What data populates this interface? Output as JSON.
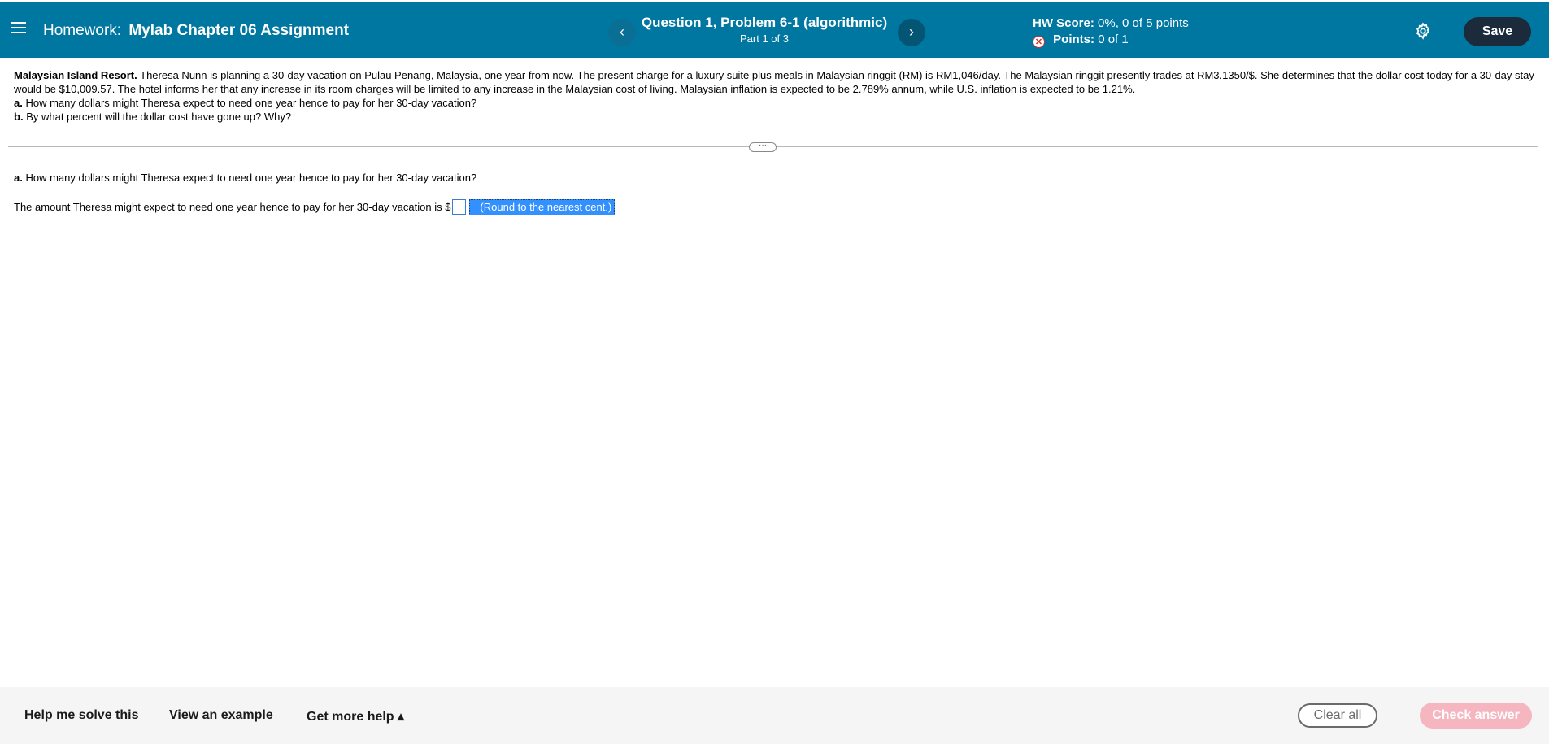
{
  "header": {
    "homework_prefix": "Homework:",
    "assignment_name": "Mylab Chapter 06 Assignment",
    "prev_label": "‹",
    "next_label": "›",
    "question_title": "Question 1, Problem 6-1 (algorithmic)",
    "part_label": "Part 1 of 3",
    "hw_score_label": "HW Score:",
    "hw_score_value": "0%, 0 of 5 points",
    "points_label": "Points:",
    "points_value": "0 of 1",
    "save_label": "Save"
  },
  "problem": {
    "title": "Malaysian Island Resort.",
    "text": "Theresa Nunn is planning a 30-day vacation on Pulau Penang, Malaysia, one year from now. The present charge for a luxury suite plus meals in Malaysian ringgit (RM) is RM1,046/day. The Malaysian ringgit presently trades at RM3.1350/$. She determines that the dollar cost today for a 30-day stay would be $10,009.57. The hotel informs her that any increase in its room charges will be limited to any increase in the Malaysian cost of living. Malaysian inflation is expected to be 2.789% annum, while U.S. inflation is expected to be 1.21%.",
    "a_label": "a.",
    "a_text": "How many dollars might Theresa expect to need one year hence to pay for her 30-day vacation?",
    "b_label": "b.",
    "b_text": "By what percent will the dollar cost have gone up? Why?"
  },
  "divider": {
    "handle_label": "···"
  },
  "part_a": {
    "label": "a.",
    "question": "How many dollars might Theresa expect to need one year hence to pay for her 30-day vacation?",
    "answer_prefix": "The amount Theresa might expect to need one year hence to pay for her 30-day vacation is $",
    "answer_value": "",
    "hint": "(Round to the nearest cent.)"
  },
  "footer": {
    "help_label": "Help me solve this",
    "example_label": "View an example",
    "more_help_label": "Get more help ▴",
    "clear_label": "Clear all",
    "check_label": "Check answer"
  },
  "colors": {
    "header_bg": "#0077a0",
    "save_bg": "#1b2b3c",
    "selection": "#3390ff",
    "check_disabled": "#f5b6c0"
  }
}
